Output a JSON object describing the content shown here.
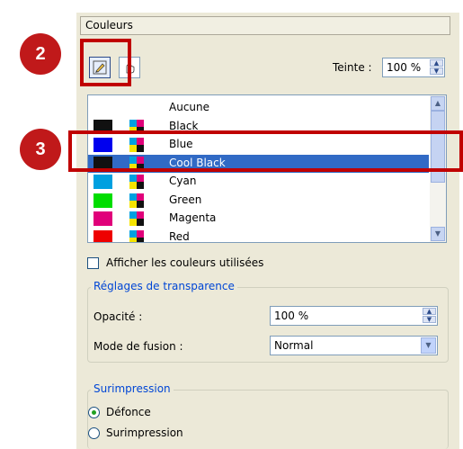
{
  "panel": {
    "title": "Couleurs"
  },
  "callouts": [
    {
      "label": "2"
    },
    {
      "label": "3"
    }
  ],
  "toolbar": {
    "fill_tool": "pen-icon",
    "stroke_tool": "hand-icon"
  },
  "tint": {
    "label": "Teinte :",
    "value": "100 %"
  },
  "swatches": [
    {
      "name": "Aucune",
      "color": "#ffffff",
      "process": false
    },
    {
      "name": "Black",
      "color": "#111111",
      "process": true
    },
    {
      "name": "Blue",
      "color": "#0000ee",
      "process": true
    },
    {
      "name": "Cool Black",
      "color": "#111111",
      "process": true,
      "selected": true
    },
    {
      "name": "Cyan",
      "color": "#00a0e0",
      "process": true
    },
    {
      "name": "Green",
      "color": "#00dd00",
      "process": true
    },
    {
      "name": "Magenta",
      "color": "#e0007a",
      "process": true
    },
    {
      "name": "Red",
      "color": "#ee0000",
      "process": true
    }
  ],
  "show_used": {
    "label": "Afficher les couleurs utilisées",
    "checked": false
  },
  "transparency": {
    "legend": "Réglages de transparence",
    "opacity_label": "Opacité :",
    "opacity_value": "100 %",
    "blend_label": "Mode de fusion :",
    "blend_value": "Normal"
  },
  "overprint": {
    "legend": "Surimpression",
    "options": [
      {
        "label": "Défonce",
        "selected": true
      },
      {
        "label": "Surimpression",
        "selected": false
      }
    ]
  },
  "colors": {
    "selection": "#316ac5",
    "callout": "#c0191a",
    "legend": "#0046d5"
  }
}
